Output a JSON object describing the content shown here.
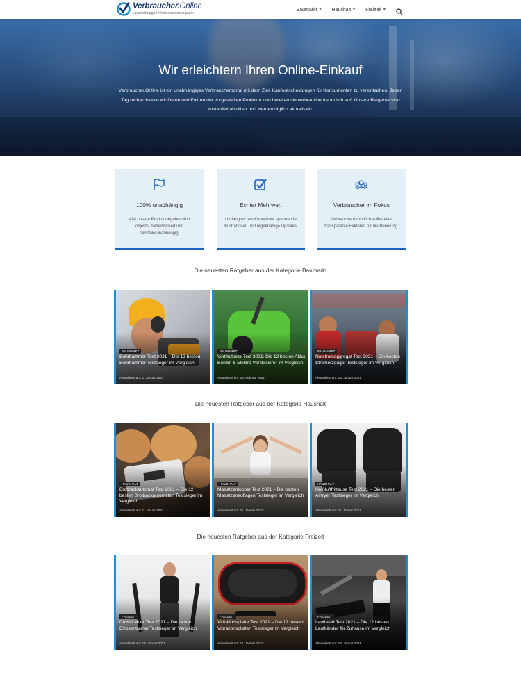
{
  "header": {
    "logo_title_bold": "Verbraucher.",
    "logo_title_light": "Online",
    "logo_subtitle": "Unabhängiges Verbrauchermagazin",
    "nav": [
      {
        "label": "Baumarkt"
      },
      {
        "label": "Haushalt"
      },
      {
        "label": "Freizeit"
      }
    ],
    "search_icon": "search-icon"
  },
  "hero": {
    "title": "Wir erleichtern Ihren Online-Einkauf",
    "text": "Verbraucher.Online ist ein unabhängiges Verbraucherportal mit dem Ziel, Kaufentscheidungen für Konsumenten zu vereinfachen. Jeden Tag recherchieren wir Daten und Fakten der vorgestellten Produkte und bereiten sie verbraucherfreundlich auf. Unsere Ratgeber sind kostenfrei abrufbar und werden täglich aktualisiert."
  },
  "features": [
    {
      "icon": "flag-icon",
      "title": "100% unabhängig",
      "text": "Alle unsere Produktratgeber sind objektiv, faktenbasiert und herstellerunabhängig."
    },
    {
      "icon": "checkbox-icon",
      "title": "Echter Mehrwert",
      "text": "Umfangreiches Know-how, spannende Illustrationen und regelmäßige Updates."
    },
    {
      "icon": "users-icon",
      "title": "Verbraucher im Fokus",
      "text": "Verbraucherfreundlich aufbereitet, transparente Faktoren für die Benotung."
    }
  ],
  "sections": [
    {
      "title": "Die neuesten Ratgeber aus der Kategorie Baumarkt",
      "cards": [
        {
          "badge": "BAUMARKT",
          "title": "Bohrhammer Test 2021 – Die 12 besten Bohrhämmer Testsieger im Vergleich",
          "date": "Aktualisiert am: 1. Januar 2021"
        },
        {
          "badge": "BAUMARKT",
          "title": "Vertikutierer Test 2021: Die 12 besten Akku, Benzin & Elektro Vertikutierer im Vergleich",
          "date": "Aktualisiert am: 25. Februar 2021"
        },
        {
          "badge": "BAUMARKT",
          "title": "Notstromaggregat Test 2021 – Die besten Stromerzeuger Testsieger im Vergleich",
          "date": "Aktualisiert am: 23. Januar 2021"
        }
      ]
    },
    {
      "title": "Die neuesten Ratgeber aus der Kategorie Haushalt",
      "cards": [
        {
          "badge": "HAUSHALT",
          "title": "Brotbackautomat Test 2021 – Die 12 besten Brotbackautomaten Testsieger im Vergleich",
          "date": "Aktualisiert am: 1. Januar 2021"
        },
        {
          "badge": "HAUSHALT",
          "title": "Matratzentopper Test 2021 – Die besten Matratzenauflagen Testsieger im Vergleich",
          "date": "Aktualisiert am: 11. Januar 2021"
        },
        {
          "badge": "HAUSHALT",
          "title": "Heißluftfritteuse Test 2021 – Die besten Airfryer Testsieger im Vergleich",
          "date": "Aktualisiert am: 11. Januar 2021"
        }
      ]
    },
    {
      "title": "Die neuesten Ratgeber aus der Kategorie Freizeit",
      "cards": [
        {
          "badge": "FREIZEIT",
          "title": "Crosstrainer Test 2021 – Die besten Ellipsentrainer Testsieger im Vergleich",
          "date": "Aktualisiert am: 14. Januar 2021"
        },
        {
          "badge": "FREIZEIT",
          "title": "Vibrationsplatte Test 2021 – Die 12 besten Vibrationsplatten Testsieger im Vergleich",
          "date": "Aktualisiert am: 11. Januar 2021"
        },
        {
          "badge": "FREIZEIT",
          "title": "Laufband Test 2021 – Die 12 besten Laufbänder für Zuhause im Vergleich",
          "date": "Aktualisiert am: 13. Januar 2021"
        }
      ]
    }
  ],
  "colors": {
    "accent": "#1b63b8",
    "card_edge": "#1b8fd8",
    "feature_bg": "#e3f1f7"
  }
}
